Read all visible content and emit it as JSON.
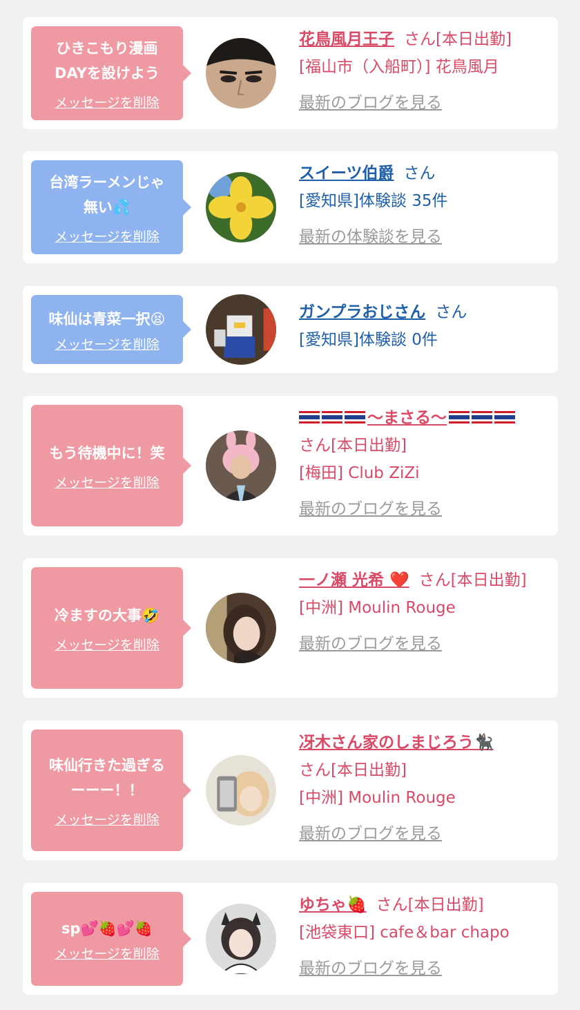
{
  "cards": [
    {
      "message": "ひきこもり漫画\nDAYを設けよう",
      "delete_label": "メッセージを削除",
      "name": "花鳥風月王子",
      "suffix": "さん[本日出勤]",
      "location": "[福山市（入船町）] 花鳥風月",
      "blog": "最新のブログを見る"
    },
    {
      "message": "台湾ラーメンじゃ\n無い💦",
      "delete_label": "メッセージを削除",
      "name": "スイーツ伯爵",
      "suffix": "さん",
      "location": "[愛知県]体験談 35件",
      "blog": "最新の体験談を見る"
    },
    {
      "message": "味仙は青菜一択😫",
      "delete_label": "メッセージを削除",
      "name": "ガンプラおじさん",
      "suffix": "さん",
      "location": "[愛知県]体験談 0件"
    },
    {
      "message": "もう待機中に！笑",
      "delete_label": "メッセージを削除",
      "name": "〜まさる〜",
      "suffix": "さん[本日出勤]",
      "location": "[梅田] Club ZiZi",
      "blog": "最新のブログを見る"
    },
    {
      "message": "冷ますの大事🤣",
      "delete_label": "メッセージを削除",
      "name": "一ノ瀬 光希 ❤️",
      "suffix": "さん[本日出勤]",
      "location": "[中洲] Moulin Rouge",
      "blog": "最新のブログを見る"
    },
    {
      "message": "味仙行きた過ぎる\nーーー！！",
      "delete_label": "メッセージを削除",
      "name": "冴木さん家のしまじろう🐈‍⬛",
      "suffix": "さん[本日出勤]",
      "location": "[中洲] Moulin Rouge",
      "blog": "最新のブログを見る"
    },
    {
      "message": "sp💕🍓💕🍓",
      "delete_label": "メッセージを削除",
      "name": "ゆちゃ🍓",
      "suffix": "さん[本日出勤]",
      "location": "[池袋東口] cafe＆bar chapo",
      "blog": "最新のブログを見る"
    }
  ],
  "colors": {
    "bubble_pink": "#ef9aa3",
    "bubble_blue": "#8fb3ef",
    "text_pink": "#d94a67",
    "text_blue": "#1f5fa8",
    "link_gray": "#9a9a9a"
  }
}
